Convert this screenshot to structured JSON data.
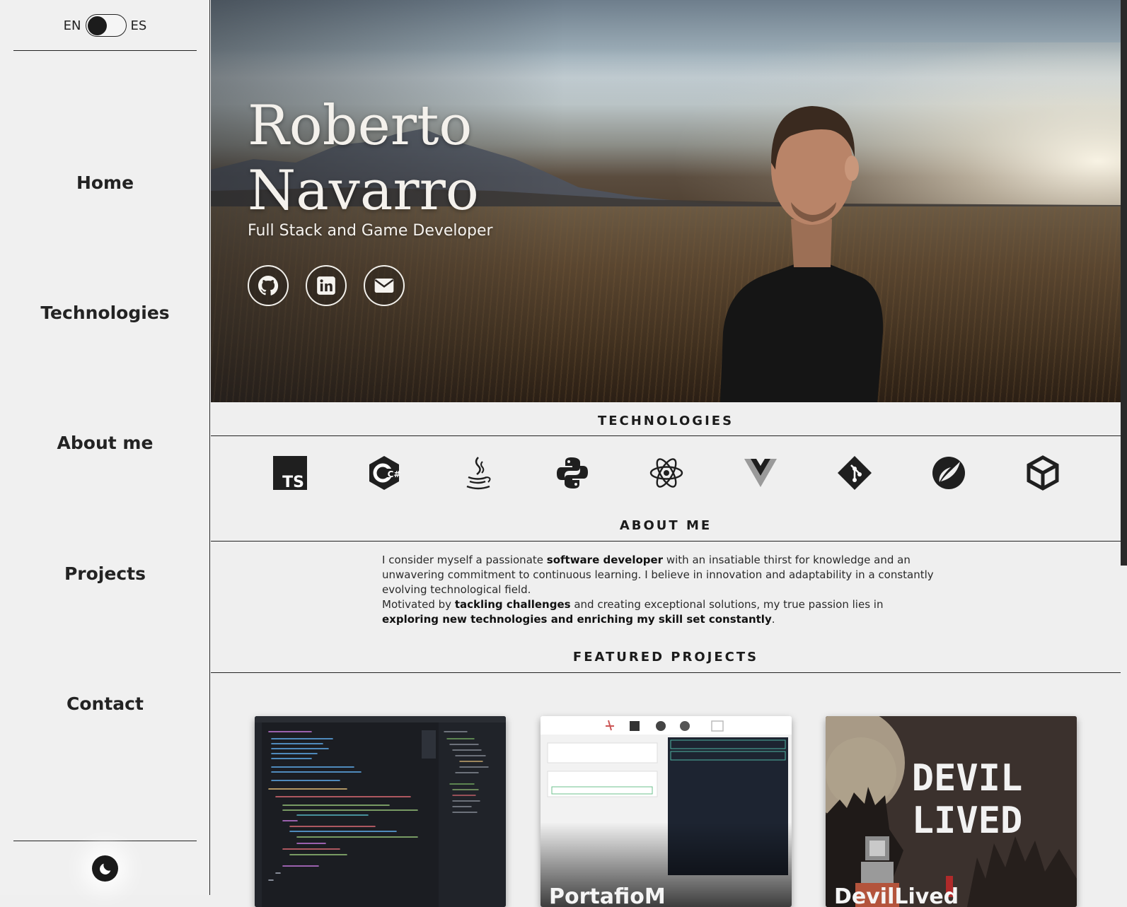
{
  "language_switch": {
    "left": "EN",
    "right": "ES",
    "state": "EN"
  },
  "nav": {
    "items": [
      {
        "label": "Home"
      },
      {
        "label": "Technologies"
      },
      {
        "label": "About me"
      },
      {
        "label": "Projects"
      },
      {
        "label": "Contact"
      }
    ]
  },
  "theme_toggle": {
    "icon": "moon-icon"
  },
  "hero": {
    "name_line1": "Roberto",
    "name_line2": "Navarro",
    "subtitle": "Full Stack and Game Developer",
    "social": [
      {
        "icon": "github-icon"
      },
      {
        "icon": "linkedin-icon"
      },
      {
        "icon": "mail-icon"
      }
    ]
  },
  "technologies": {
    "title": "TECHNOLOGIES",
    "icons": [
      {
        "icon": "typescript-icon",
        "text": "TS"
      },
      {
        "icon": "csharp-icon",
        "text": "C#"
      },
      {
        "icon": "java-icon"
      },
      {
        "icon": "python-icon"
      },
      {
        "icon": "react-icon"
      },
      {
        "icon": "vue-icon"
      },
      {
        "icon": "git-icon"
      },
      {
        "icon": "spring-icon"
      },
      {
        "icon": "unity-icon"
      }
    ]
  },
  "about": {
    "title": "ABOUT ME",
    "p1_a": "I consider myself a passionate ",
    "p1_b": "software developer",
    "p1_c": " with an insatiable thirst for knowledge and an unwavering commitment to continuous learning. I believe in innovation and adaptability in a constantly evolving technological field.",
    "p2_a": "Motivated by ",
    "p2_b": "tackling challenges",
    "p2_c": " and creating exceptional solutions, my true passion lies in ",
    "p2_d": "exploring new technologies and enriching my skill set constantly",
    "p2_e": "."
  },
  "projects": {
    "title": "FEATURED PROJECTS",
    "cards": [
      {
        "title": ""
      },
      {
        "title": "PortafioM"
      },
      {
        "title": "DevilLived"
      }
    ],
    "card3_art_text": "DEVIL LIVED"
  },
  "colors": {
    "background": "#efefef",
    "text": "#1e1e1e",
    "accent_dark": "#1a1a1a"
  }
}
